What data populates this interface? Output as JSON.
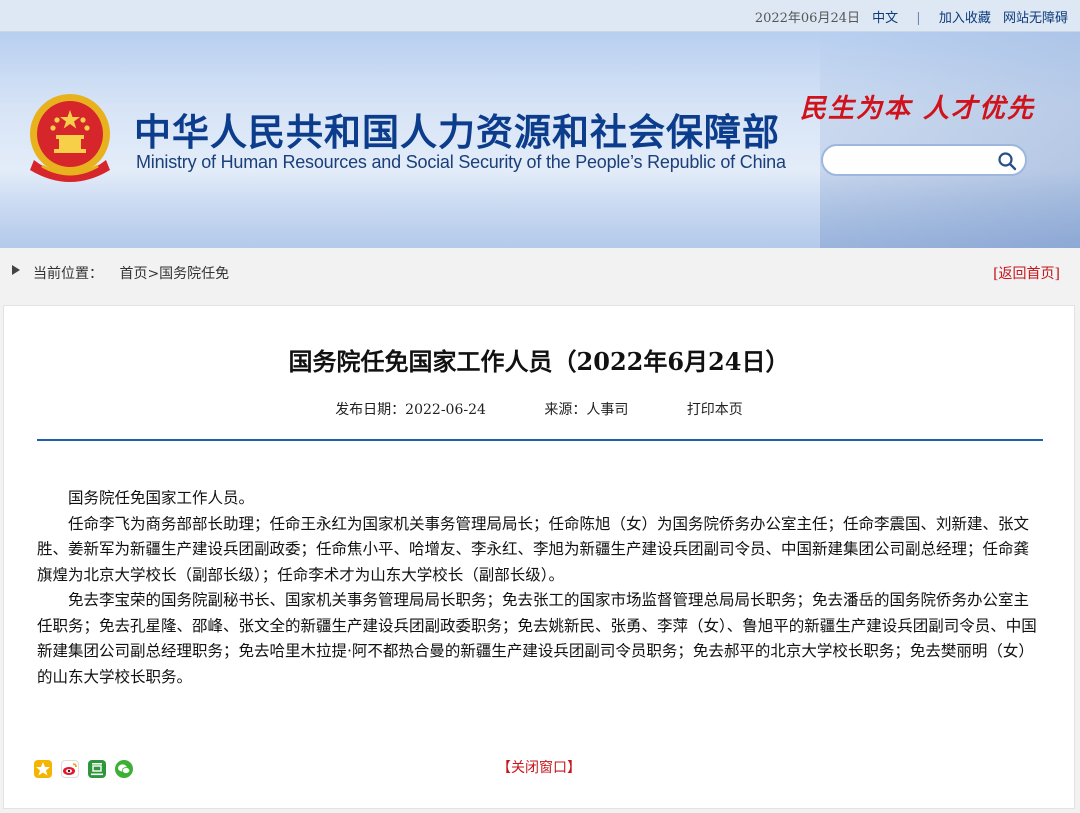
{
  "topbar": {
    "date": "2022年06月24日",
    "lang": "中文",
    "separator": "|",
    "favorite": "加入收藏",
    "accessibility": "网站无障碍"
  },
  "banner": {
    "title_cn": "中华人民共和国人力资源和社会保障部",
    "title_en": "Ministry of Human Resources and Social Security of the People’s Republic of China",
    "slogan": "民生为本 人才优先",
    "search_placeholder": ""
  },
  "breadcrumb": {
    "label": "当前位置：",
    "path": "首页>国务院任免",
    "back": "[返回首页]"
  },
  "article": {
    "title": "国务院任免国家工作人员（2022年6月24日）",
    "publish_date": "发布日期：2022-06-24",
    "source": "来源：人事司",
    "print": "打印本页",
    "paragraphs": [
      "国务院任免国家工作人员。",
      "任命李飞为商务部部长助理；任命王永红为国家机关事务管理局局长；任命陈旭（女）为国务院侨务办公室主任；任命李震国、刘新建、张文胜、姜新军为新疆生产建设兵团副政委；任命焦小平、哈增友、李永红、李旭为新疆生产建设兵团副司令员、中国新建集团公司副总经理；任命龚旗煌为北京大学校长（副部长级）；任命李术才为山东大学校长（副部长级）。",
      "免去李宝荣的国务院副秘书长、国家机关事务管理局局长职务；免去张工的国家市场监督管理总局局长职务；免去潘岳的国务院侨务办公室主任职务；免去孔星隆、邵峰、张文全的新疆生产建设兵团副政委职务；免去姚新民、张勇、李萍（女）、鲁旭平的新疆生产建设兵团副司令员、中国新建集团公司副总经理职务；免去哈里木拉提·阿不都热合曼的新疆生产建设兵团副司令员职务；免去郝平的北京大学校长职务；免去樊丽明（女）的山东大学校长职务。"
    ],
    "close": "【关闭窗口】"
  },
  "share_icons": [
    "qzone-icon",
    "weibo-icon",
    "douban-icon",
    "wechat-icon"
  ],
  "colors": {
    "brand_blue": "#0c3c8c",
    "accent_red": "#c4161c",
    "rule_blue": "#1f5fa8"
  }
}
